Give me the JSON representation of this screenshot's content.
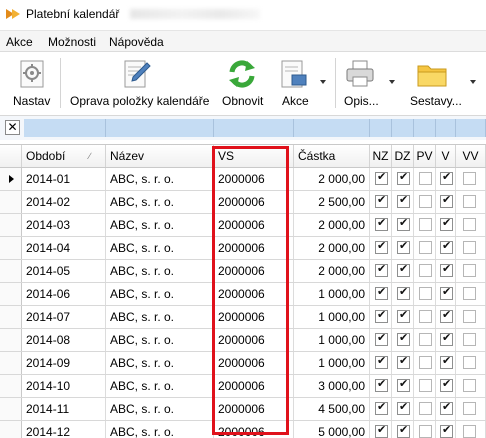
{
  "window": {
    "title": "Platební kalendář"
  },
  "menu": {
    "items": [
      "Akce",
      "Možnosti",
      "Nápověda"
    ]
  },
  "toolbar": {
    "buttons": [
      {
        "label": "Nastav",
        "icon": "settings-sheet-icon"
      },
      {
        "label": "Oprava položky kalendáře",
        "icon": "edit-document-icon"
      },
      {
        "label": "Obnovit",
        "icon": "refresh-icon"
      },
      {
        "label": "Akce",
        "icon": "actions-document-icon",
        "dropdown": true
      },
      {
        "label": "Opis...",
        "icon": "printer-icon",
        "dropdown": true
      },
      {
        "label": "Sestavy...",
        "icon": "folder-icon",
        "dropdown": true
      }
    ]
  },
  "grid": {
    "columns": [
      "Období",
      "Název",
      "VS",
      "Částka",
      "NZ",
      "DZ",
      "PV",
      "V",
      "VV"
    ],
    "rows": [
      {
        "obdobi": "2014-01",
        "nazev": "ABC, s. r. o.",
        "vs": "2000006",
        "castka": "2 000,00",
        "nz": true,
        "dz": true,
        "pv": false,
        "v": true,
        "vv": false
      },
      {
        "obdobi": "2014-02",
        "nazev": "ABC, s. r. o.",
        "vs": "2000006",
        "castka": "2 500,00",
        "nz": true,
        "dz": true,
        "pv": false,
        "v": true,
        "vv": false
      },
      {
        "obdobi": "2014-03",
        "nazev": "ABC, s. r. o.",
        "vs": "2000006",
        "castka": "2 000,00",
        "nz": true,
        "dz": true,
        "pv": false,
        "v": true,
        "vv": false
      },
      {
        "obdobi": "2014-04",
        "nazev": "ABC, s. r. o.",
        "vs": "2000006",
        "castka": "2 000,00",
        "nz": true,
        "dz": true,
        "pv": false,
        "v": true,
        "vv": false
      },
      {
        "obdobi": "2014-05",
        "nazev": "ABC, s. r. o.",
        "vs": "2000006",
        "castka": "2 000,00",
        "nz": true,
        "dz": true,
        "pv": false,
        "v": true,
        "vv": false
      },
      {
        "obdobi": "2014-06",
        "nazev": "ABC, s. r. o.",
        "vs": "2000006",
        "castka": "1 000,00",
        "nz": true,
        "dz": true,
        "pv": false,
        "v": true,
        "vv": false
      },
      {
        "obdobi": "2014-07",
        "nazev": "ABC, s. r. o.",
        "vs": "2000006",
        "castka": "1 000,00",
        "nz": true,
        "dz": true,
        "pv": false,
        "v": true,
        "vv": false
      },
      {
        "obdobi": "2014-08",
        "nazev": "ABC, s. r. o.",
        "vs": "2000006",
        "castka": "1 000,00",
        "nz": true,
        "dz": true,
        "pv": false,
        "v": true,
        "vv": false
      },
      {
        "obdobi": "2014-09",
        "nazev": "ABC, s. r. o.",
        "vs": "2000006",
        "castka": "1 000,00",
        "nz": true,
        "dz": true,
        "pv": false,
        "v": true,
        "vv": false
      },
      {
        "obdobi": "2014-10",
        "nazev": "ABC, s. r. o.",
        "vs": "2000006",
        "castka": "3 000,00",
        "nz": true,
        "dz": true,
        "pv": false,
        "v": true,
        "vv": false
      },
      {
        "obdobi": "2014-11",
        "nazev": "ABC, s. r. o.",
        "vs": "2000006",
        "castka": "4 500,00",
        "nz": true,
        "dz": true,
        "pv": false,
        "v": true,
        "vv": false
      },
      {
        "obdobi": "2014-12",
        "nazev": "ABC, s. r. o.",
        "vs": "2000006",
        "castka": "5 000,00",
        "nz": true,
        "dz": true,
        "pv": false,
        "v": true,
        "vv": false
      }
    ]
  },
  "colors": {
    "highlight": "#e0111b",
    "filter": "#c5dcf3",
    "refresh_green": "#3aa83a"
  }
}
